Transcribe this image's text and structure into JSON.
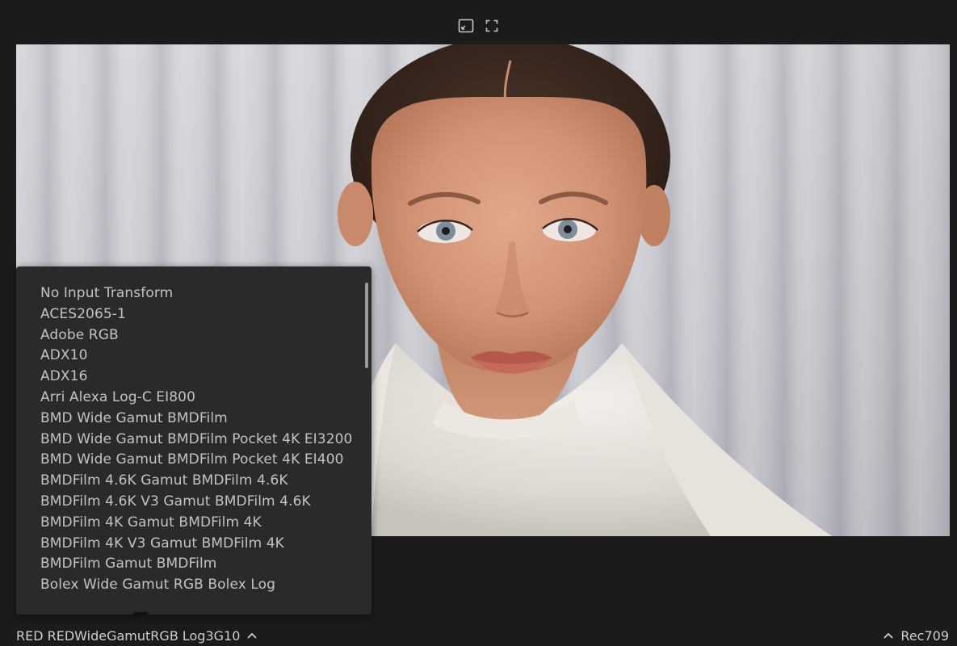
{
  "toolbar": {
    "fit_icon": "fit-to-window-icon",
    "fullscreen_icon": "fullscreen-icon"
  },
  "input_transform_menu": {
    "items": [
      "No Input Transform",
      "ACES2065-1",
      "Adobe RGB",
      "ADX10",
      "ADX16",
      "Arri Alexa Log-C EI800",
      "BMD Wide Gamut BMDFilm",
      "BMD Wide Gamut BMDFilm Pocket 4K EI3200",
      "BMD Wide Gamut BMDFilm Pocket 4K EI400",
      "BMDFilm 4.6K Gamut BMDFilm 4.6K",
      "BMDFilm 4.6K V3 Gamut BMDFilm 4.6K",
      "BMDFilm 4K Gamut BMDFilm 4K",
      "BMDFilm 4K V3 Gamut BMDFilm 4K",
      "BMDFilm Gamut BMDFilm",
      "Bolex Wide Gamut RGB Bolex Log"
    ]
  },
  "bottom_bar": {
    "input_transform_value": "RED REDWideGamutRGB Log3G10",
    "output_transform_value": "Rec709"
  },
  "colors": {
    "background": "#1b1b1b",
    "menu_background": "#2a2a2a",
    "text": "#c3c3c3"
  }
}
